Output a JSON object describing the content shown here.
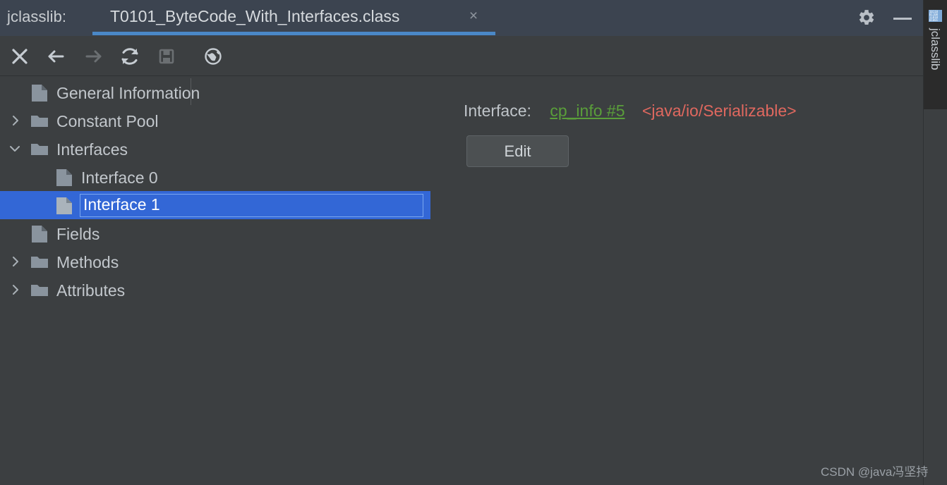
{
  "window": {
    "app_name": "jclasslib:",
    "tab_title": "T0101_ByteCode_With_Interfaces.class",
    "tab_close_glyph": "×",
    "settings_icon": "gear-icon",
    "minimize_icon": "minimize-icon",
    "accent_color": "#4a88c7",
    "titlebar_color": "#3c4450",
    "background_color": "#3c3f41"
  },
  "toolbar": {
    "buttons": [
      {
        "name": "close-icon",
        "title": "Close",
        "enabled": true
      },
      {
        "name": "back-icon",
        "title": "Back",
        "enabled": true
      },
      {
        "name": "forward-icon",
        "title": "Forward",
        "enabled": false
      },
      {
        "name": "reload-icon",
        "title": "Reload",
        "enabled": true
      },
      {
        "name": "save-icon",
        "title": "Save",
        "enabled": false
      },
      {
        "name": "browse-icon",
        "title": "Browse",
        "enabled": true
      }
    ]
  },
  "tree": {
    "nodes": [
      {
        "label": "General Information",
        "icon": "file-icon",
        "chevron": "none",
        "depth": 1,
        "selected": false
      },
      {
        "label": "Constant Pool",
        "icon": "folder-icon",
        "chevron": "collapsed",
        "depth": 1,
        "selected": false
      },
      {
        "label": "Interfaces",
        "icon": "folder-icon",
        "chevron": "expanded",
        "depth": 1,
        "selected": false
      },
      {
        "label": "Interface 0",
        "icon": "file-icon",
        "chevron": "none",
        "depth": 2,
        "selected": false
      },
      {
        "label": "Interface 1",
        "icon": "file-icon",
        "chevron": "none",
        "depth": 2,
        "selected": true
      },
      {
        "label": "Fields",
        "icon": "file-icon",
        "chevron": "none",
        "depth": 1,
        "selected": false
      },
      {
        "label": "Methods",
        "icon": "folder-icon",
        "chevron": "collapsed",
        "depth": 1,
        "selected": false
      },
      {
        "label": "Attributes",
        "icon": "folder-icon",
        "chevron": "collapsed",
        "depth": 1,
        "selected": false
      }
    ],
    "selection_color": "#3367d6"
  },
  "detail": {
    "field_label": "Interface:",
    "constant_link": "cp_info #5",
    "constant_value": "<java/io/Serializable>",
    "link_color": "#5a9e3a",
    "value_color": "#e0685f",
    "edit_label": "Edit"
  },
  "tool_strip": {
    "label": "jclasslib",
    "icon": "bytecode-icon"
  },
  "watermark": {
    "text": "CSDN @java冯坚持"
  }
}
